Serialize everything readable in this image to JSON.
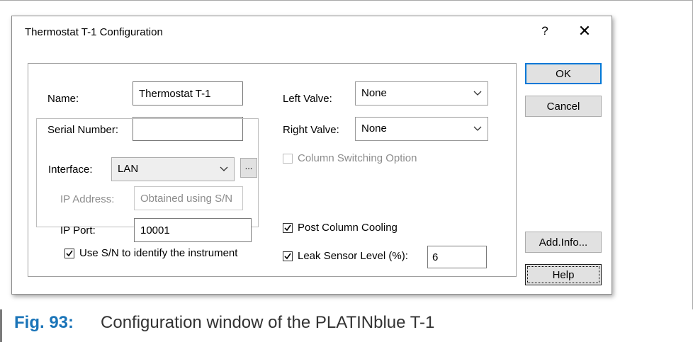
{
  "dialog": {
    "title": "Thermostat T-1 Configuration",
    "help_glyph": "?",
    "close_glyph": "✕"
  },
  "fields": {
    "name_label": "Name:",
    "name_value": "Thermostat T-1",
    "serial_label": "Serial Number:",
    "serial_value": "",
    "interface_label": "Interface:",
    "interface_value": "LAN",
    "ellipsis_label": "...",
    "ip_address_label": "IP Address:",
    "ip_address_value": "Obtained using S/N",
    "ip_port_label": "IP Port:",
    "ip_port_value": "10001",
    "use_sn_label": "Use S/N to identify the instrument",
    "use_sn_checked": true,
    "left_valve_label": "Left Valve:",
    "left_valve_value": "None",
    "right_valve_label": "Right Valve:",
    "right_valve_value": "None",
    "column_switching_label": "Column Switching Option",
    "column_switching_checked": false,
    "post_column_label": "Post Column Cooling",
    "post_column_checked": true,
    "leak_sensor_label": "Leak Sensor Level (%):",
    "leak_sensor_checked": true,
    "leak_sensor_value": "6"
  },
  "buttons": {
    "ok": "OK",
    "cancel": "Cancel",
    "add_info": "Add.Info...",
    "help": "Help"
  },
  "caption": {
    "number": "Fig. 93:",
    "text": "Configuration window of the PLATINblue T-1"
  },
  "colors": {
    "accent": "#0078d7",
    "caption_number": "#1a74b8"
  }
}
